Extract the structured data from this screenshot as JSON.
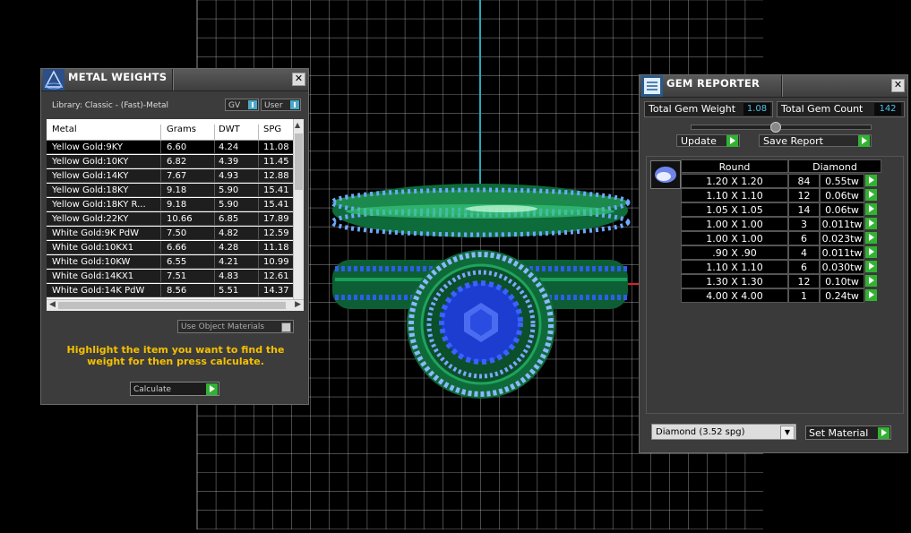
{
  "viewport": {
    "label": "3D viewport (front view)",
    "grid_color": "#c8c8c8"
  },
  "metal_weights": {
    "title": "METAL WEIGHTS",
    "library_label": "Library: Classic - (Fast)-Metal",
    "toggle_gv": "GV",
    "toggle_user": "User",
    "columns": [
      "Metal",
      "Grams",
      "DWT",
      "SPG"
    ],
    "rows": [
      {
        "metal": "Yellow Gold:9KY",
        "grams": "6.60",
        "dwt": "4.24",
        "spg": "11.08"
      },
      {
        "metal": "Yellow Gold:10KY",
        "grams": "6.82",
        "dwt": "4.39",
        "spg": "11.45"
      },
      {
        "metal": "Yellow Gold:14KY",
        "grams": "7.67",
        "dwt": "4.93",
        "spg": "12.88"
      },
      {
        "metal": "Yellow Gold:18KY",
        "grams": "9.18",
        "dwt": "5.90",
        "spg": "15.41"
      },
      {
        "metal": "Yellow Gold:18KY R...",
        "grams": "9.18",
        "dwt": "5.90",
        "spg": "15.41"
      },
      {
        "metal": "Yellow Gold:22KY",
        "grams": "10.66",
        "dwt": "6.85",
        "spg": "17.89"
      },
      {
        "metal": "White Gold:9K PdW",
        "grams": "7.50",
        "dwt": "4.82",
        "spg": "12.59"
      },
      {
        "metal": "White Gold:10KX1",
        "grams": "6.66",
        "dwt": "4.28",
        "spg": "11.18"
      },
      {
        "metal": "White Gold:10KW",
        "grams": "6.55",
        "dwt": "4.21",
        "spg": "10.99"
      },
      {
        "metal": "White Gold:14KX1",
        "grams": "7.51",
        "dwt": "4.83",
        "spg": "12.61"
      },
      {
        "metal": "White Gold:14K PdW",
        "grams": "8.56",
        "dwt": "5.51",
        "spg": "14.37"
      }
    ],
    "use_object_materials": "Use Object Materials",
    "hint": "Highlight the item you want to find the weight for then press calculate.",
    "calculate_label": "Calculate",
    "hint_color": "#f5c000"
  },
  "gem_reporter": {
    "title": "GEM REPORTER",
    "total_weight_label": "Total Gem Weight",
    "total_weight_value": "1.08",
    "total_count_label": "Total Gem Count",
    "total_count_value": "142",
    "update_label": "Update",
    "save_report_label": "Save Report",
    "col_round": "Round",
    "col_diamond": "Diamond",
    "rows": [
      {
        "size": "1.20 X 1.20",
        "count": "84",
        "tw": "0.55tw"
      },
      {
        "size": "1.10 X 1.10",
        "count": "12",
        "tw": "0.06tw"
      },
      {
        "size": "1.05 X 1.05",
        "count": "14",
        "tw": "0.06tw"
      },
      {
        "size": "1.00 X 1.00",
        "count": "3",
        "tw": "0.011tw"
      },
      {
        "size": "1.00 X 1.00",
        "count": "6",
        "tw": "0.023tw"
      },
      {
        "size": ".90 X .90",
        "count": "4",
        "tw": "0.011tw"
      },
      {
        "size": "1.10 X 1.10",
        "count": "6",
        "tw": "0.030tw"
      },
      {
        "size": "1.30 X 1.30",
        "count": "12",
        "tw": "0.10tw"
      },
      {
        "size": "4.00 X 4.00",
        "count": "1",
        "tw": "0.24tw"
      }
    ],
    "material_selected": "Diamond    (3.52 spg)",
    "set_material_label": "Set Material",
    "value_color": "#4ec1e8",
    "button_green": "#32b232"
  }
}
